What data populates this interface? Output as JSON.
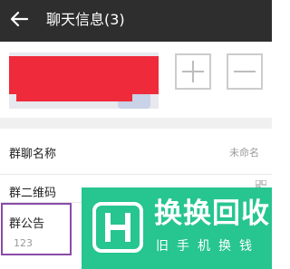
{
  "header": {
    "title": "聊天信息(3)"
  },
  "members": {
    "add_icon": "plus-icon",
    "remove_icon": "minus-icon"
  },
  "settings": {
    "group_name": {
      "label": "群聊名称",
      "value": "未命名"
    },
    "group_qr": {
      "label": "群二维码"
    },
    "group_notice": {
      "label": "群公告",
      "value": "123"
    }
  },
  "watermark": {
    "brand": "换换回收",
    "subtitle": "旧手机换钱"
  },
  "colors": {
    "header_bg": "#2e2e2e",
    "highlight_border": "#8a4ca8",
    "redaction": "#ef2a3b",
    "watermark_bg": "#27c590"
  }
}
